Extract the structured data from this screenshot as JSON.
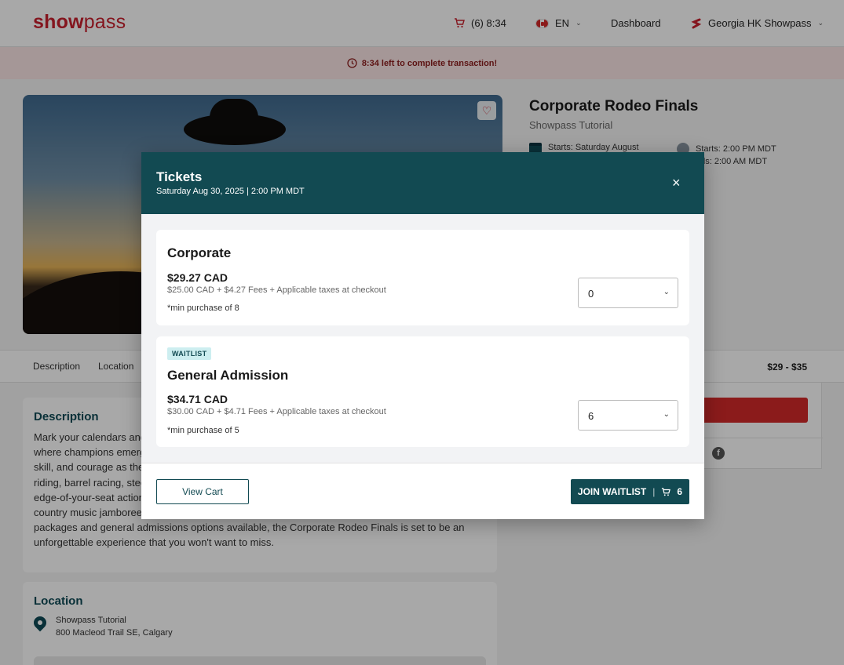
{
  "header": {
    "logo_left": "show",
    "logo_right": "pass",
    "cart_count": "(6) 8:34",
    "language": "EN",
    "dashboard": "Dashboard",
    "user": "Georgia HK Showpass"
  },
  "banner": {
    "text": "8:34 left to complete transaction!"
  },
  "event": {
    "title": "Corporate Rodeo Finals",
    "organizer": "Showpass Tutorial",
    "starts_date": "Starts: Saturday August",
    "starts_time": "Starts: 2:00 PM MDT",
    "ends_time": "nds: 2:00 AM MDT",
    "price_range": "$29 - $35"
  },
  "tabs": {
    "description": "Description",
    "location": "Location"
  },
  "description": {
    "title": "Description",
    "lines": [
      "Mark your calendars and",
      "where champions emerg",
      "skill, and courage as the f",
      "riding, barrel racing, stee",
      "edge-of-your-seat action",
      "country music jamboree",
      "packages and general admissions options available, the Corporate Rodeo Finals is set to be an",
      "unforgettable experience that you won't want to miss."
    ]
  },
  "location": {
    "title": "Location",
    "venue": "Showpass Tutorial",
    "address": "800 Macleod Trail SE, Calgary"
  },
  "modal": {
    "title": "Tickets",
    "date": "Saturday Aug 30, 2025 | 2:00 PM MDT",
    "close": "×",
    "tickets": [
      {
        "name": "Corporate",
        "price": "$29.27 CAD",
        "fees": "$25.00 CAD + $4.27 Fees + Applicable taxes at checkout",
        "min": "*min purchase of 8",
        "quantity": "0"
      },
      {
        "badge": "WAITLIST",
        "name": "General Admission",
        "price": "$34.71 CAD",
        "fees": "$30.00 CAD + $4.71 Fees + Applicable taxes at checkout",
        "min": "*min purchase of 5",
        "quantity": "6"
      }
    ],
    "view_cart": "View Cart",
    "join_waitlist": "JOIN WAITLIST",
    "cart_badge_count": "6"
  },
  "colors": {
    "brand_red": "#c9202e",
    "primary_teal": "#124a52",
    "banner_bg": "#fbe6e5"
  }
}
